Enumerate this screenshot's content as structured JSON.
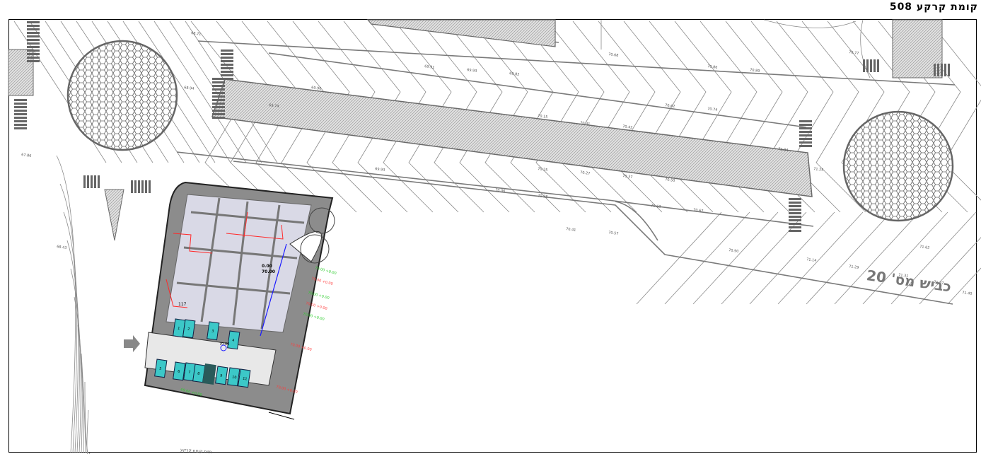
{
  "sheet": {
    "title": "קומת קרקע 508",
    "road_label": "כביש מס' 20",
    "building_level_top": "0.00",
    "building_level_bottom": "70.00",
    "entrance_level": "70.00",
    "room_label": "117",
    "bottom_caption": "חזית קומת קרקע"
  },
  "elevations": [
    "69.91",
    "69.93",
    "69.82",
    "70.15",
    "70.31",
    "70.42",
    "70.62",
    "70.74",
    "69.74",
    "69.90",
    "70.25",
    "70.27",
    "70.37",
    "70.50",
    "71.04",
    "71.25",
    "69.93",
    "70.06",
    "70.38",
    "70.41",
    "70.57",
    "70.63",
    "70.67",
    "70.90",
    "71.14",
    "71.29",
    "71.31",
    "71.37",
    "71.40",
    "71.62",
    "68.94",
    "68.71",
    "67.86",
    "68.43",
    "70.77",
    "70.68",
    "70.86",
    "70.89"
  ],
  "red_labels": [
    "70.00 +0.00",
    "70.00 +0.00",
    "70.00 +0.00",
    "70.00 +0.00",
    "70.00 +0.00",
    "70.00 +0.00",
    "69.60 +0.00",
    "70.00 +0.00"
  ],
  "parking_numbers": [
    "1",
    "2",
    "3",
    "4",
    "5",
    "6",
    "7",
    "8",
    "9",
    "10",
    "11"
  ],
  "colors": {
    "line": "#7a7a7a",
    "hatch": "#c8c8c8",
    "building": "#8c8c8c",
    "room": "#e4e4f0",
    "parking": "#3cc8c8",
    "red": "#ff2a2a",
    "magenta": "#ff00ff",
    "green": "#33dd33",
    "blue": "#1a1aff"
  }
}
